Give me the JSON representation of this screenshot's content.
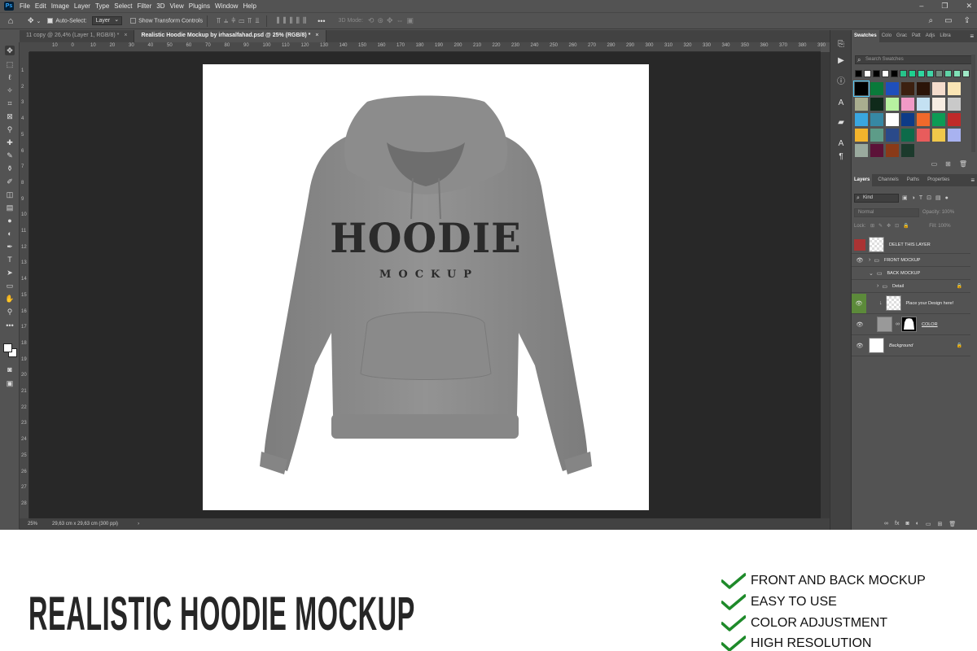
{
  "menu": {
    "items": [
      "File",
      "Edit",
      "Image",
      "Layer",
      "Type",
      "Select",
      "Filter",
      "3D",
      "View",
      "Plugins",
      "Window",
      "Help"
    ],
    "app_icon": "Ps"
  },
  "options": {
    "auto_select_label": "Auto-Select:",
    "auto_select_value": "Layer",
    "show_transform_label": "Show Transform Controls",
    "mode_label": "3D Mode:",
    "more": "•••"
  },
  "tabs": [
    {
      "label": "11 copy @ 26,4% (Layer 1, RGB/8) *",
      "close": "×"
    },
    {
      "label": "Realistic Hoodie Mockup by irhasalfahad.psd @ 25% (RGB/8) *",
      "close": "×"
    }
  ],
  "rulers": {
    "top": [
      "10",
      "0",
      "10",
      "20",
      "30",
      "40",
      "50",
      "60",
      "70",
      "80",
      "90",
      "100",
      "110",
      "120",
      "130",
      "140",
      "150",
      "160",
      "170",
      "180",
      "190",
      "200",
      "210",
      "220",
      "230",
      "240",
      "250",
      "260",
      "270",
      "280",
      "290",
      "300",
      "310",
      "320",
      "330",
      "340",
      "350",
      "360",
      "370",
      "380",
      "390",
      "400"
    ],
    "left": [
      "1",
      "2",
      "3",
      "4",
      "5",
      "6",
      "7",
      "8",
      "9",
      "10",
      "11",
      "12",
      "13",
      "14",
      "15",
      "16",
      "17",
      "18",
      "19",
      "20",
      "21",
      "22",
      "23",
      "24",
      "25",
      "26",
      "27",
      "28"
    ]
  },
  "status": {
    "zoom": "25%",
    "doc_info": "29,63 cm x 29,63 cm (300 ppi)",
    "arrow": "›"
  },
  "artwork": {
    "title": "HOODIE",
    "subtitle": "MOCKUP"
  },
  "swatches": {
    "tabs": [
      "Swatches",
      "Colo",
      "Grac",
      "Patt",
      "Adjs",
      "Libra"
    ],
    "search_placeholder": "Search Swatches",
    "recent": [
      "#000000",
      "#ffffff",
      "#000000",
      "#ffffff",
      "#000000",
      "#27c38a",
      "#1fd08f",
      "#2fd6a0",
      "#40d4a6",
      "#6f8f80",
      "#5fd4a6",
      "#7fe0b6",
      "#9fe7c5"
    ],
    "grid": [
      "#000000",
      "#0a7a3a",
      "#1e4fbb",
      "#3c2010",
      "#2b1408",
      "#f4dccc",
      "#f9e4b4",
      "#a9ad8f",
      "#0f2a1a",
      "#b7f2a0",
      "#f19ac6",
      "#c4e1f2",
      "#f6ece2",
      "#c9c9c9",
      "#3aa6e0",
      "#3688a4",
      "#ffffff",
      "#0d3b87",
      "#f1692b",
      "#0d9b55",
      "#c02a2a",
      "#f3b42c",
      "#5d9c88",
      "#2a4a8a",
      "#0d6b4a",
      "#e85c5c",
      "#f0c84a",
      "#a8b2f0",
      "#9aaa9e",
      "#5c1238",
      "#8a3a18",
      "#1c3a2c"
    ]
  },
  "layers_panel": {
    "tabs": [
      "Layers",
      "Channels",
      "Paths",
      "Properties"
    ],
    "filter": "Kind",
    "blend_mode": "Normal",
    "opacity_label": "Opacity:",
    "opacity_value": "100%",
    "lock_label": "Lock:",
    "fill_label": "Fill:",
    "fill_value": "100%",
    "layers": [
      {
        "name": "DELET THIS LAYER",
        "kind": "pixel"
      },
      {
        "name": "FRONT MOCKUP",
        "kind": "group"
      },
      {
        "name": "BACK MOCKUP",
        "kind": "group"
      },
      {
        "name": "Detail",
        "kind": "group"
      },
      {
        "name": "Place your Design here!",
        "kind": "smart"
      },
      {
        "name": "COLOR",
        "kind": "fill"
      },
      {
        "name": "Background",
        "kind": "background"
      }
    ]
  },
  "promo": {
    "headline": "REALISTIC HOODIE MOCKUP",
    "features": [
      "FRONT AND BACK MOCKUP",
      "EASY TO USE",
      "COLOR ADJUSTMENT",
      "HIGH RESOLUTION"
    ],
    "check_color": "#1e8a2a"
  }
}
